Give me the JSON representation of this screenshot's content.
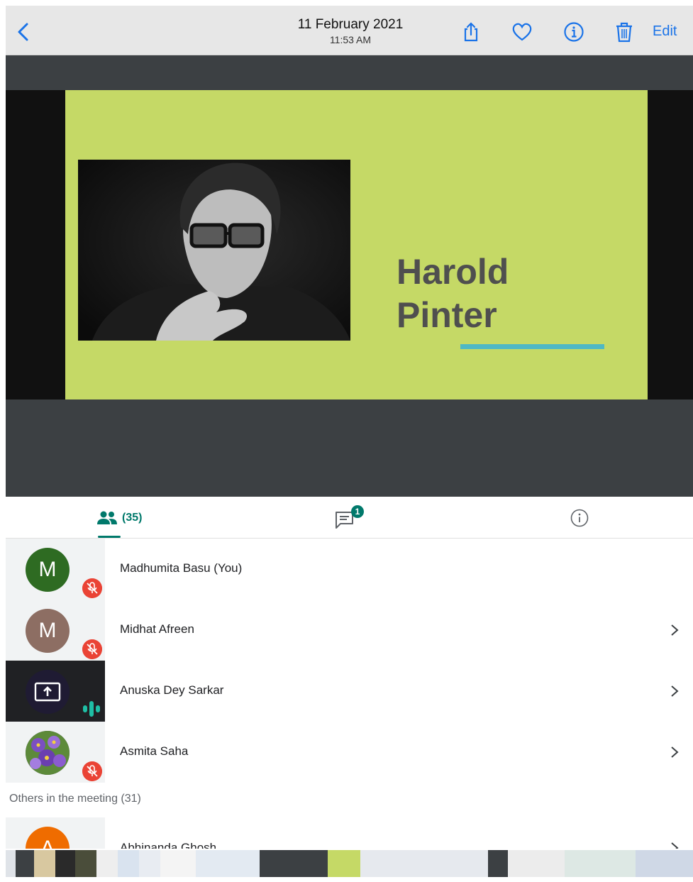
{
  "topbar": {
    "date": "11 February 2021",
    "time": "11:53 AM",
    "edit_label": "Edit",
    "icons": [
      "chevron-left-icon",
      "share-icon",
      "heart-icon",
      "info-icon",
      "trash-icon"
    ]
  },
  "slide": {
    "title_line1": "Harold",
    "title_line2": "Pinter",
    "background": "#c5d966",
    "accent": "#4fb8c4"
  },
  "tabs": {
    "people_count": "(35)",
    "chat_badge": "1"
  },
  "participants": [
    {
      "initial": "M",
      "name": "Madhumita Basu (You)",
      "avatar_color": "#2e6b22",
      "muted": true
    },
    {
      "initial": "M",
      "name": "Midhat Afreen",
      "avatar_color": "#8d6e63",
      "muted": true
    },
    {
      "initial": "",
      "name": "Anuska Dey Sarkar",
      "avatar_color": "#1f1b33",
      "presenting": true
    },
    {
      "initial": "",
      "name": "Asmita Saha",
      "avatar_color": "#6b4aa0",
      "muted": true
    }
  ],
  "others": {
    "label": "Others in the meeting (31)",
    "first": {
      "initial": "A",
      "name": "Abhinanda Ghosh",
      "avatar_color": "#ef6c00"
    }
  },
  "colors": {
    "teal": "#00796b",
    "mute_red": "#ea4335",
    "ios_blue": "#1a73e8"
  }
}
